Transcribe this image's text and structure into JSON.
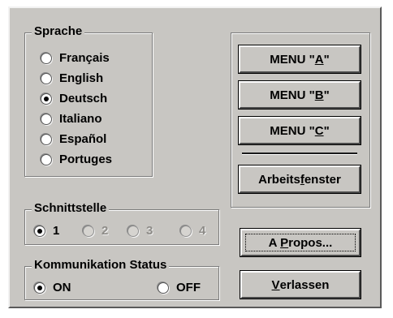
{
  "language_group": {
    "title": "Sprache",
    "options": [
      {
        "label": "Français",
        "checked": false
      },
      {
        "label": "English",
        "checked": false
      },
      {
        "label": "Deutsch",
        "checked": true
      },
      {
        "label": "Italiano",
        "checked": false
      },
      {
        "label": "Español",
        "checked": false
      },
      {
        "label": "Portuges",
        "checked": false
      }
    ]
  },
  "interface_group": {
    "title": "Schnittstelle",
    "options": [
      {
        "label": "1",
        "checked": true,
        "enabled": true
      },
      {
        "label": "2",
        "checked": false,
        "enabled": false
      },
      {
        "label": "3",
        "checked": false,
        "enabled": false
      },
      {
        "label": "4",
        "checked": false,
        "enabled": false
      }
    ]
  },
  "status_group": {
    "title": "Kommunikation Status",
    "options": [
      {
        "label": "ON",
        "checked": true
      },
      {
        "label": "OFF",
        "checked": false
      }
    ]
  },
  "menu_buttons": {
    "a": {
      "prefix": "MENU \"",
      "key": "A",
      "suffix": "\""
    },
    "b": {
      "prefix": "MENU \"",
      "key": "B",
      "suffix": "\""
    },
    "c": {
      "prefix": "MENU \"",
      "key": "C",
      "suffix": "\""
    }
  },
  "work_window_button": {
    "prefix": "Arbeits",
    "key": "f",
    "suffix": "enster"
  },
  "about_button": {
    "prefix": "A ",
    "key": "P",
    "suffix": "ropos..."
  },
  "exit_button": {
    "prefix": "",
    "key": "V",
    "suffix": "erlassen"
  }
}
